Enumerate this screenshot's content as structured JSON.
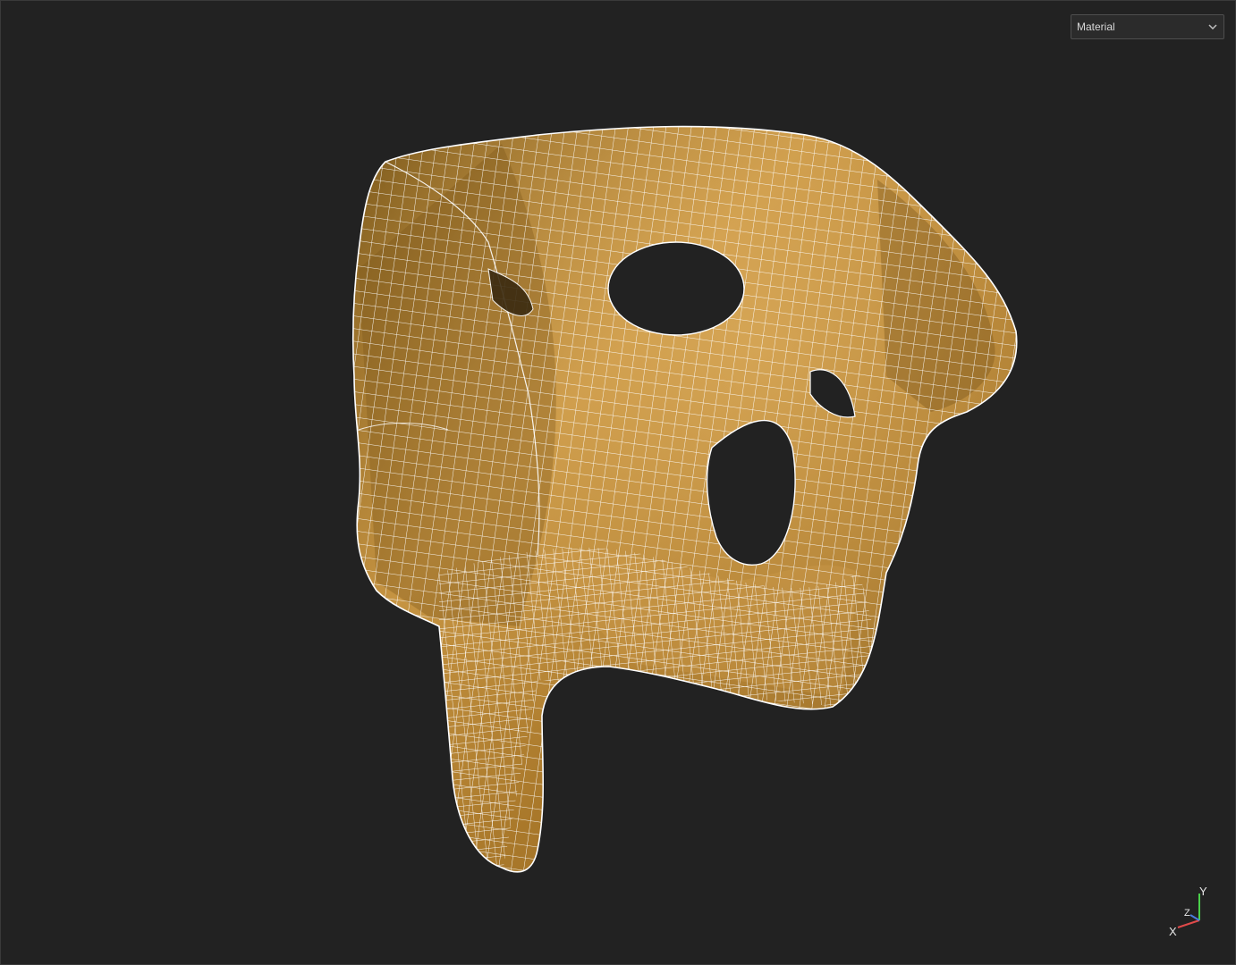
{
  "viewport": {
    "background": "#222222",
    "shading_mode": {
      "value": "Material",
      "icon": "chevron-down-icon"
    },
    "model": {
      "description_color": "#b9852f",
      "wire_color": "#ffffff"
    },
    "axes": {
      "x_label": "X",
      "y_label": "Y",
      "z_label": "Z",
      "x_color": "#e04a4a",
      "y_color": "#4ad04a",
      "z_color": "#4a7ae0"
    }
  }
}
